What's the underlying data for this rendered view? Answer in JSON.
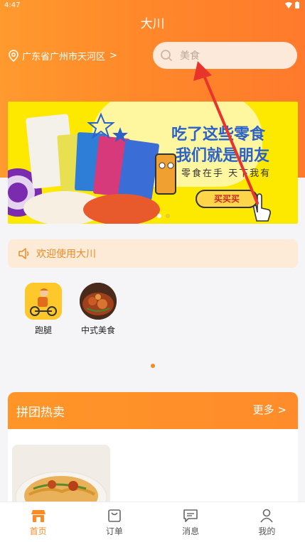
{
  "status_bar": {
    "time": "4:47"
  },
  "header": {
    "title": "大川"
  },
  "location": {
    "text": "广东省广州市天河区",
    "chevron": ">"
  },
  "search": {
    "placeholder": "美食"
  },
  "banner": {
    "line1": "吃了这些零食",
    "line2": "我们就是朋友",
    "line3": "零食在手 天下我有",
    "button": "买买买"
  },
  "notice": {
    "text": "欢迎使用大川"
  },
  "categories": [
    {
      "label": "跑腿",
      "icon": "delivery-rider-icon"
    },
    {
      "label": "中式美食",
      "icon": "chinese-food-icon"
    }
  ],
  "group_section": {
    "title": "拼团热卖",
    "more": "更多 >"
  },
  "tabs": [
    {
      "label": "首页",
      "icon": "home-icon"
    },
    {
      "label": "订单",
      "icon": "order-bag-icon"
    },
    {
      "label": "消息",
      "icon": "message-icon"
    },
    {
      "label": "我的",
      "icon": "profile-icon"
    }
  ],
  "colors": {
    "primary": "#ff8a24",
    "banner_yellow": "#fde800",
    "notice_bg": "#fdebd8"
  }
}
